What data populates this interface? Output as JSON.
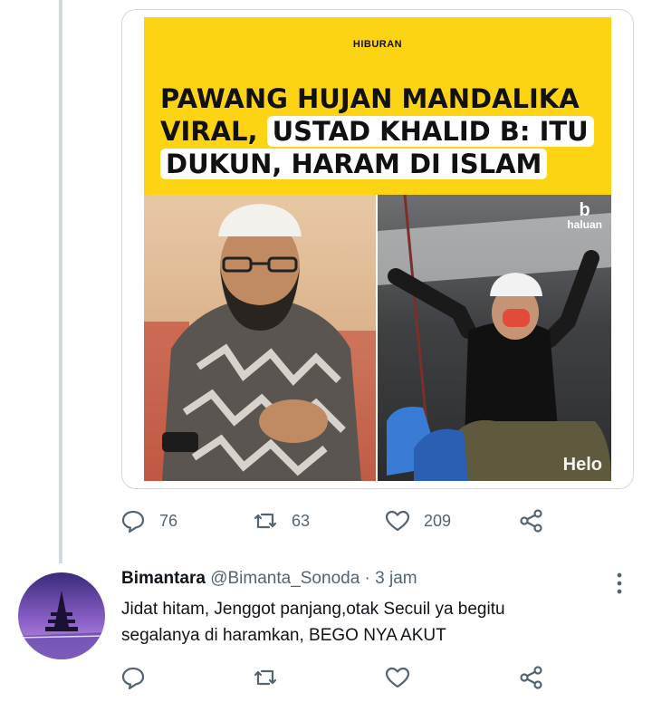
{
  "tweet": {
    "media": {
      "category": "HIBURAN",
      "headline_plain": "PAWANG HUJAN MANDALIKA VIRAL, ",
      "headline_highlight": "USTAD KHALID B: ITU DUKUN, HARAM DI ISLAM",
      "brand_logo": "haluan",
      "watermark": "Helo"
    },
    "actions": {
      "reply_count": "76",
      "retweet_count": "63",
      "like_count": "209"
    }
  },
  "reply": {
    "display_name": "Bimantara",
    "handle": "@Bimanta_Sonoda",
    "separator": "·",
    "time": "3 jam",
    "text_line1": "Jidat hitam, Jenggot panjang,otak Secuil ya begitu",
    "text_line2": "segalanya di haramkan, BEGO NYA AKUT"
  },
  "colors": {
    "muted": "#536471",
    "border": "#cfd9de",
    "headline_yellow": "#fdd414"
  }
}
